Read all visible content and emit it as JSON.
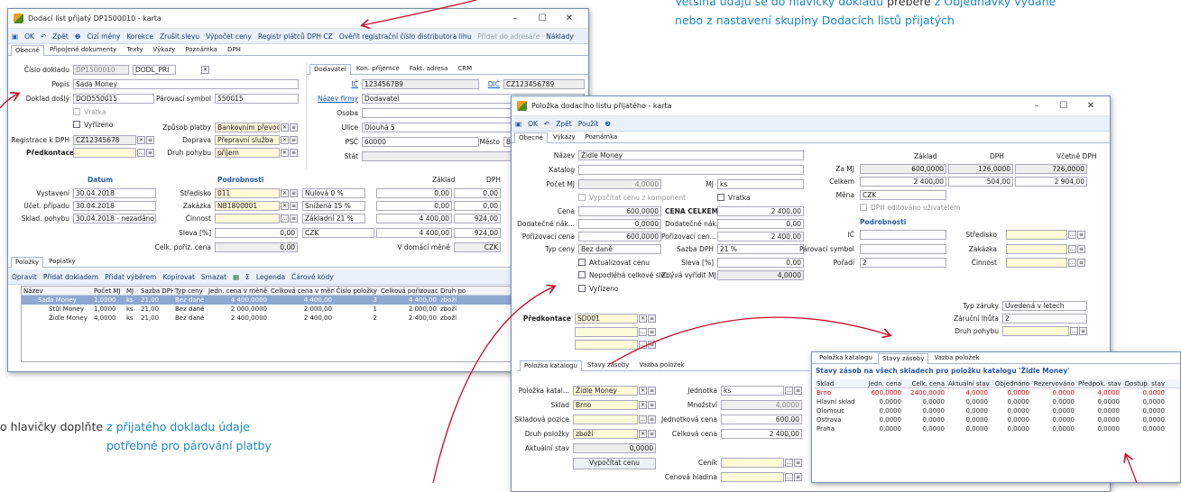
{
  "notes": {
    "top_blue": "Většina údajů se do hlavičky dokladu ",
    "top_dark": "přebere ",
    "top_blue2": "z Objednávky vydané",
    "top_line2": "nebo z nastavení skupiny Dodacích listů přijatých",
    "bottom_dark1": "o hlavičky doplňte ",
    "bottom_blue1": "z přijatého dokladu údaje",
    "bottom_line2": "potřebné pro párování platby"
  },
  "w1": {
    "title": "Dodací list přijatý DP1500010 - karta",
    "toolbar": [
      "OK",
      "Zpět",
      "Cizí měny",
      "Korekce",
      "Zrušit slevu",
      "Výpočet ceny",
      "Registr plátců DPH CZ",
      "Ověřit registrační číslo distributora lihu",
      "Přidat do adresáře",
      "Náklady"
    ],
    "tabs": [
      "Obecné",
      "Připojené dokumenty",
      "Texty",
      "Výkazy",
      "Poznámka",
      "DPH"
    ],
    "cislo_dokladu_label": "Číslo dokladu",
    "cislo_dokladu": "DP1500010",
    "druh": "DODL_PRI",
    "popis_label": "Popis",
    "popis": "Sada Money",
    "doklad_dosly_label": "Doklad došlý",
    "doklad_dosly": "DOD550015",
    "parovaci_label": "Párovací symbol",
    "parovaci": "550015",
    "vratka": "Vratka",
    "vyrizeno": "Vyřízeno",
    "zpusob_platby_label": "Způsob platby",
    "zpusob_platby": "Bankovním převodem",
    "registrace_label": "Registrace k DPH",
    "registrace": "CZ12345678",
    "doprava_label": "Doprava",
    "doprava": "Přepravní služba",
    "predkontace_label": "Předkontace",
    "druh_pohybu_label": "Druh pohybu",
    "druh_pohybu": "příjem",
    "right_tabs": [
      "Dodavatel",
      "Kon. příjemce",
      "Fakt. adresa",
      "CRM"
    ],
    "ic_label": "IČ",
    "ic": "123456789",
    "dic_label": "DIČ",
    "dic": "CZ123456789",
    "nazev_firmy_label": "Název firmy",
    "nazev_firmy": "Dodavatel",
    "osoba_label": "Osoba",
    "ulice_label": "Ulice",
    "ulice": "Dlouhá 5",
    "psc_label": "PSČ",
    "psc": "60000",
    "mesto_label": "Město",
    "mesto": "Br",
    "stat_label": "Stát",
    "datum_hdr": "Datum",
    "podrobnosti_hdr": "Podrobnosti",
    "vystaveni_label": "Vystavení",
    "vystaveni": "30.04.2018",
    "ucet_label": "Účet. případu",
    "ucet": "30.04.2018",
    "sklad_label": "Sklad. pohybu",
    "sklad": "30.04.2018 - nezadáno",
    "stredisko_label": "Středisko",
    "stredisko": "011",
    "zakazka_label": "Zakázka",
    "zakazka": "NB1800001",
    "cinnost_label": "Činnost",
    "sleva_label": "Sleva [%]",
    "sleva": "0,00",
    "celk_label": "Celk. pořiz. cena",
    "celk": "0,00",
    "zaklad_hdr": "Základ",
    "dph_hdr": "DPH",
    "rates": [
      {
        "n": "Nulová 0 %",
        "z": "0,00",
        "d": "0,00"
      },
      {
        "n": "Snížená 15 %",
        "z": "0,00",
        "d": "0,00"
      },
      {
        "n": "Základní 21 %",
        "z": "4 400,00",
        "d": "924,00"
      }
    ],
    "mena": "CZK",
    "mena_z": "4 400,00",
    "mena_d": "924,00",
    "domaci_label": "V domácí měně",
    "domaci": "CZK",
    "bottom_tabs": [
      "Položky",
      "Poplatky"
    ],
    "grid_toolbar": [
      "Opravit",
      "Přidat dokladem",
      "Přidat výběrem",
      "Kopírovat",
      "Smazat",
      "Legenda",
      "Čárové kódy"
    ],
    "cols": [
      "Název",
      "Počet MJ",
      "MJ",
      "Sazba DPH",
      "Typ ceny",
      "Jedn. cena v měně",
      "Celková cena v měně",
      "Číslo položky",
      "Celková pořizovací cena",
      "Druh po"
    ],
    "rows": [
      [
        "Sada Money",
        "1,0000",
        "ks",
        "21,00",
        "Bez daně",
        "4 400,0000",
        "4 400,00",
        "3",
        "4 400,00",
        "zboží"
      ],
      [
        "Stůl Money",
        "1,0000",
        "ks",
        "21,00",
        "Bez daně",
        "2 000,0000",
        "2 000,00",
        "1",
        "2 000,00",
        "zboží"
      ],
      [
        "Židle Money",
        "4,0000",
        "ks",
        "21,00",
        "Bez daně",
        "2 400,0000",
        "2 400,00",
        "2",
        "2 400,00",
        "zboží"
      ]
    ]
  },
  "w2": {
    "title": "Položka dodacího listu přijatého - karta",
    "toolbar": [
      "OK",
      "Zpět",
      "Použít"
    ],
    "tabs": [
      "Obecné",
      "Výkazy",
      "Poznámka"
    ],
    "nazev_label": "Název",
    "nazev": "Židle Money",
    "katalog_label": "Katalog",
    "pocet_label": "Počet MJ",
    "pocet": "4,0000",
    "mj_label": "MJ",
    "mj": "ks",
    "vypocet_label": "Vypočítat cenu z komponent",
    "vratka": "Vratka",
    "cena_label": "Cena",
    "cena": "600,0000",
    "cena_celkem_label": "CENA CELKEM",
    "cena_celkem": "2 400,00",
    "dodat_label": "Dodatečné nák...",
    "dodat": "0,0000",
    "dodat2_label": "Dodatečné nák...",
    "dodat2": "0,00",
    "poriz_label": "Pořizovací cena",
    "poriz": "600,0000",
    "poriz2_label": "Pořizovací cen...",
    "poriz2": "2 400,00",
    "typ_label": "Typ ceny",
    "typ": "Bez daně",
    "sazba_label": "Sazba DPH",
    "sazba": "21 %",
    "aktualizovat": "Aktualizovat cenu",
    "sleva_label": "Sleva [%]",
    "sleva": "0,00",
    "nepodleha": "Nepodléhá celkové sle...",
    "zbyva_label": "Zbývá vyřídit MJ",
    "zbyva": "4,0000",
    "vyrizeno": "Vyřízeno",
    "predkontace_label": "Předkontace",
    "predkontace": "SD001",
    "zaklad_hdr": "Základ",
    "dph_hdr": "DPH",
    "vcetne_hdr": "Včetně DPH",
    "zamj_label": "Za MJ",
    "zamj": [
      "600,0000",
      "126,0000",
      "726,0000"
    ],
    "celkem_label": "Celkem",
    "celkem": [
      "2 400,00",
      "504,00",
      "2 904,00"
    ],
    "mena_label": "Měna",
    "mena": "CZK",
    "dph_edit": "DPH editováno uživatelem",
    "podrobnosti_hdr": "Podrobnosti",
    "ic_label": "IČ",
    "stredisko_label": "Středisko",
    "parovaci_label": "Párovací symbol",
    "zakazka_label": "Zakázka",
    "poradi_label": "Pořadí",
    "poradi": "2",
    "cinnost_label": "Činnost",
    "typ_zaruky_label": "Typ záruky",
    "typ_zaruky": "Uvedená v letech",
    "zarucni_label": "Záruční lhůta",
    "zarucni": "2",
    "druh_pohybu_label": "Druh pohybu",
    "bottom_tabs": [
      "Položka katalogu",
      "Stavy zásoby",
      "Vazba položek"
    ],
    "polozka_label": "Položka katal...",
    "polozka": "Židle Money",
    "jednotka_label": "Jednotka",
    "jednotka": "ks",
    "sklad_label": "Sklad",
    "sklad": "Brno",
    "mnozstvi_label": "Množství",
    "mnozstvi": "4,0000",
    "skladova_label": "Skladová pozice",
    "jednotkova_label": "Jednotková cena",
    "jednotkova": "600,00",
    "druh_label": "Druh položky",
    "druh": "zboží",
    "celkova_label": "Celková cena",
    "celkova": "2 400,00",
    "aktualni_label": "Aktuální stav",
    "aktualni": "0,0000",
    "vypocitat_btn": "Vypočítat cenu",
    "cenik_label": "Ceník",
    "cenova_label": "Cenová hladina"
  },
  "w3": {
    "tabs": [
      "Položka katalogu",
      "Stavy zásoby",
      "Vazba položek"
    ],
    "header": "Stavy zásob na všech skladech pro položku katalogu 'Židle Money'",
    "cols": [
      "Sklad",
      "Jedn. cena",
      "Celk. cena",
      "Aktuální stav",
      "Objednáno",
      "Rezervováno",
      "Předpok. stav",
      "Dostup. stav"
    ],
    "rows": [
      [
        "Brno",
        "600,0000",
        "2400,0000",
        "4,0000",
        "0,0000",
        "0,0000",
        "4,0000",
        "0,0000"
      ],
      [
        "Hlavní sklad",
        "0,0000",
        "0,0000",
        "0,0000",
        "0,0000",
        "0,0000",
        "0,0000",
        "0,0000"
      ],
      [
        "Olomouc",
        "0,0000",
        "0,0000",
        "0,0000",
        "0,0000",
        "0,0000",
        "0,0000",
        "0,0000"
      ],
      [
        "Ostrava",
        "0,0000",
        "0,0000",
        "0,0000",
        "0,0000",
        "0,0000",
        "0,0000",
        "0,0000"
      ],
      [
        "Praha",
        "0,0000",
        "0,0000",
        "0,0000",
        "0,0000",
        "0,0000",
        "0,0000",
        "0,0000"
      ]
    ]
  },
  "colors": {
    "accent": "#1e87c8",
    "arrow": "#c8102e",
    "highlight_row": "#d00000"
  }
}
